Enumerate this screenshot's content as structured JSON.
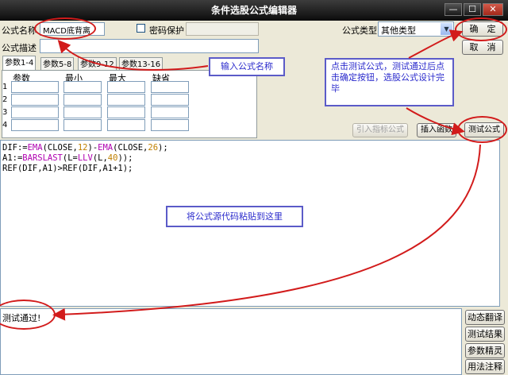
{
  "window": {
    "title": "条件选股公式编辑器",
    "min": "—",
    "max": "☐",
    "close": "✕"
  },
  "form": {
    "name_label": "公式名称",
    "name_value": "MACD底背离",
    "password_label": "密码保护",
    "desc_label": "公式描述",
    "type_label": "公式类型",
    "type_value": "其他类型"
  },
  "buttons": {
    "ok": "确　定",
    "cancel": "取　消",
    "import_indicator": "引入指标公式",
    "insert_function": "插入函数",
    "test_formula": "测试公式"
  },
  "tabs": [
    "参数1-4",
    "参数5-8",
    "参数9-12",
    "参数13-16"
  ],
  "params": {
    "headers": [
      "参数",
      "最小",
      "最大",
      "缺省"
    ],
    "rows": [
      "1",
      "2",
      "3",
      "4"
    ]
  },
  "code": {
    "line1": {
      "a": "DIF:=",
      "f1": "EMA",
      "b": "(CLOSE,",
      "n1": "12",
      "c": ")-",
      "f2": "EMA",
      "d": "(CLOSE,",
      "n2": "26",
      "e": ");"
    },
    "line2": {
      "a": "A1:=",
      "f1": "BARSLAST",
      "b": "(L=",
      "f2": "LLV",
      "c": "(L,",
      "n1": "40",
      "d": "));"
    },
    "line3": {
      "a": "REF(DIF,A1)>REF(DIF,A1+1);"
    }
  },
  "status_text": "测试通过!",
  "side_buttons": [
    "动态翻译",
    "测试结果",
    "参数精灵",
    "用法注释"
  ],
  "annotations": {
    "name_hint": "输入公式名称",
    "test_hint": "点击测试公式，测试通过后点击确定按钮，选股公式设计完毕",
    "paste_hint": "将公式源代码粘贴到这里"
  },
  "colors": {
    "annotation_red": "#d21b1b",
    "callout_border": "#5b5bc8",
    "callout_text": "#2a2acc"
  }
}
